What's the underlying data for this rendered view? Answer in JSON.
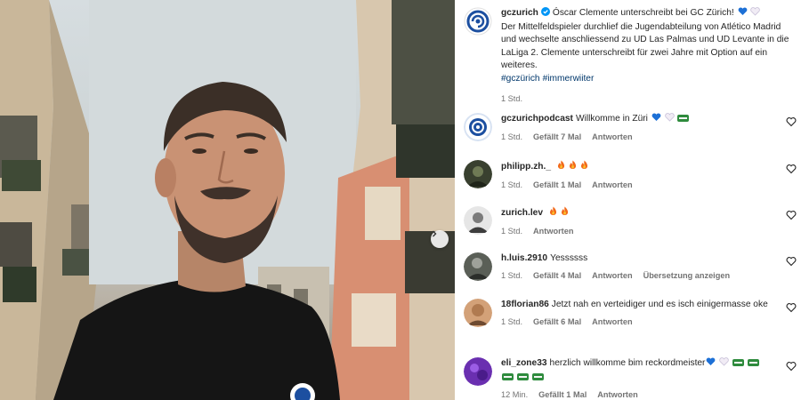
{
  "photo": {
    "next_label": "Next"
  },
  "post": {
    "username": "gczurich",
    "verified": true,
    "caption_title": "Óscar Clemente unterschreibt bei GC Zürich!",
    "caption_body": "Der Mittelfeldspieler durchlief die Jugendabteilung von Atlético Madrid und wechselte anschliessend zu UD Las Palmas und UD Levante in die LaLiga 2. Clemente unterschreibt für zwei Jahre mit Option auf ein weiteres.",
    "hashtags": [
      "#gczürich",
      "#immerwiiter"
    ],
    "time": "1 Std."
  },
  "comments": [
    {
      "username": "gczurichpodcast",
      "text": "Willkomme in Züri",
      "time": "1 Std.",
      "likes": "Gefällt 7 Mal",
      "reply": "Antworten",
      "translate": ""
    },
    {
      "username": "philipp.zh._",
      "text": "",
      "time": "1 Std.",
      "likes": "Gefällt 1 Mal",
      "reply": "Antworten",
      "translate": ""
    },
    {
      "username": "zurich.lev",
      "text": "",
      "time": "1 Std.",
      "likes": "",
      "reply": "Antworten",
      "translate": ""
    },
    {
      "username": "h.luis.2910",
      "text": "Yessssss",
      "time": "1 Std.",
      "likes": "Gefällt 4 Mal",
      "reply": "Antworten",
      "translate": "Übersetzung anzeigen"
    },
    {
      "username": "18florian86",
      "text": "Jetzt nah en verteidiger und es isch einigermasse oke",
      "time": "1 Std.",
      "likes": "Gefällt 6 Mal",
      "reply": "Antworten",
      "translate": ""
    },
    {
      "username": "eli_zone33",
      "text": "herzlich willkomme bim reckordmeister",
      "time": "12 Min.",
      "likes": "Gefällt 1 Mal",
      "reply": "Antworten",
      "translate": ""
    }
  ],
  "colors": {
    "accent_blue": "#0095f6",
    "hashtag_blue": "#00376b",
    "meta_grey": "#737373",
    "gc_blue": "#1c4fa0"
  },
  "icons": {
    "verified": "verified-badge-icon",
    "like": "heart-outline-icon",
    "next": "chevron-right-icon",
    "blue_heart": "blue-heart-emoji",
    "white_heart": "white-heart-emoji",
    "fire": "fire-emoji",
    "flag": "flag-emoji"
  }
}
